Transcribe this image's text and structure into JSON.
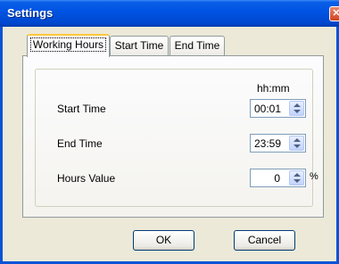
{
  "window": {
    "title": "Settings",
    "close_glyph": "✕"
  },
  "tabs": [
    {
      "label": "Working Hours",
      "active": true
    },
    {
      "label": "Start Time",
      "active": false
    },
    {
      "label": "End Time",
      "active": false
    }
  ],
  "form": {
    "format_hint": "hh:mm",
    "start_time": {
      "label": "Start Time",
      "value": "00:01"
    },
    "end_time": {
      "label": "End Time",
      "value": "23:59"
    },
    "hours_value": {
      "label": "Hours Value",
      "value": "0",
      "unit": "%"
    }
  },
  "buttons": {
    "ok": "OK",
    "cancel": "Cancel"
  },
  "colors": {
    "title_bar": "#0054e3",
    "dialog_bg": "#ece9d8",
    "active_tab_accent": "#ffc83c"
  }
}
